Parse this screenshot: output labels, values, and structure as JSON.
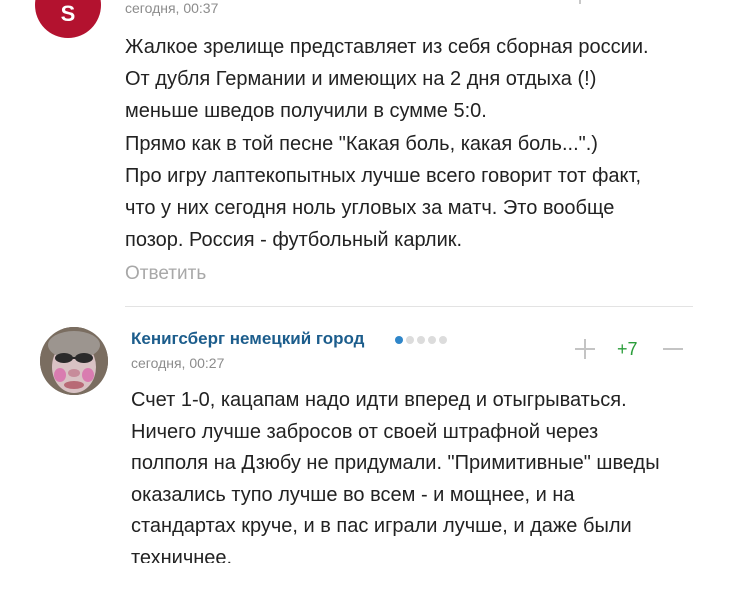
{
  "comments": [
    {
      "avatar_letter": "S",
      "avatar_color": "#b3122f",
      "time": "сегодня, 00:37",
      "lines": [
        "Жалкое зрелище представляет из себя сборная россии.",
        "От дубля Германии и имеющих на 2 дня отдыха (!)",
        "меньше шведов получили в сумме 5:0.",
        "Прямо как в той песне \"Какая боль, какая боль...\".)",
        "Про игру лаптекопытных лучше всего говорит тот факт,",
        "что у них сегодня ноль угловых за матч. Это вообще",
        "позор. Россия - футбольный карлик."
      ],
      "reply_label": "Ответить",
      "score_color": "#2a9d3a"
    },
    {
      "author": "Кенигсберг немецкий город",
      "author_color": "#1c5d8c",
      "rating_level": 1,
      "rating_max": 5,
      "time": "сегодня, 00:27",
      "score": "+7",
      "score_color": "#2a9d3a",
      "lines": [
        "Счет 1-0, кацапам надо идти вперед и отыгрываться.",
        "Ничего лучше забросов от своей штрафной через",
        "полполя на Дзюбу не придумали. \"Примитивные\" шведы",
        "оказались тупо лучше во всем - и мощнее, и на",
        "стандартах круче, и в пас играли лучше, и даже были",
        "техничнее."
      ]
    }
  ],
  "icons": {
    "upvote": "plus-icon",
    "downvote": "minus-icon",
    "rating": "rating-dots-icon"
  }
}
